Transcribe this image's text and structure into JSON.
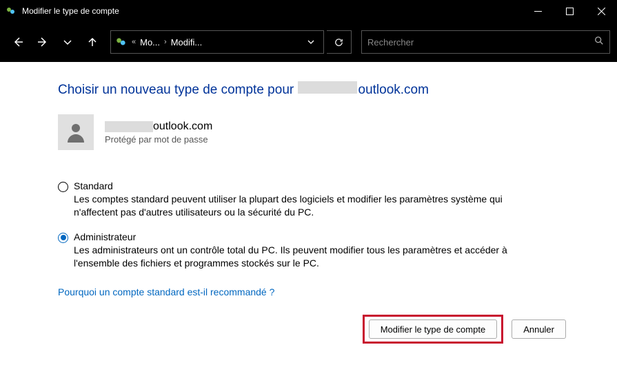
{
  "window": {
    "title": "Modifier le type de compte"
  },
  "breadcrumb": {
    "seg1": "Mo...",
    "seg2": "Modifi..."
  },
  "search": {
    "placeholder": "Rechercher"
  },
  "page": {
    "heading_prefix": "Choisir un nouveau type de compte pour ",
    "heading_suffix": "outlook.com",
    "user_email_suffix": "outlook.com",
    "user_sub": "Protégé par mot de passe"
  },
  "options": {
    "standard": {
      "label": "Standard",
      "desc": "Les comptes standard peuvent utiliser la plupart des logiciels et modifier les paramètres système qui n'affectent pas d'autres utilisateurs ou la sécurité du PC."
    },
    "admin": {
      "label": "Administrateur",
      "desc": "Les administrateurs ont un contrôle total du PC. Ils peuvent modifier tous les paramètres et accéder à l'ensemble des fichiers et programmes stockés sur le PC."
    }
  },
  "help_link": "Pourquoi un compte standard est-il recommandé ?",
  "buttons": {
    "primary": "Modifier le type de compte",
    "cancel": "Annuler"
  }
}
